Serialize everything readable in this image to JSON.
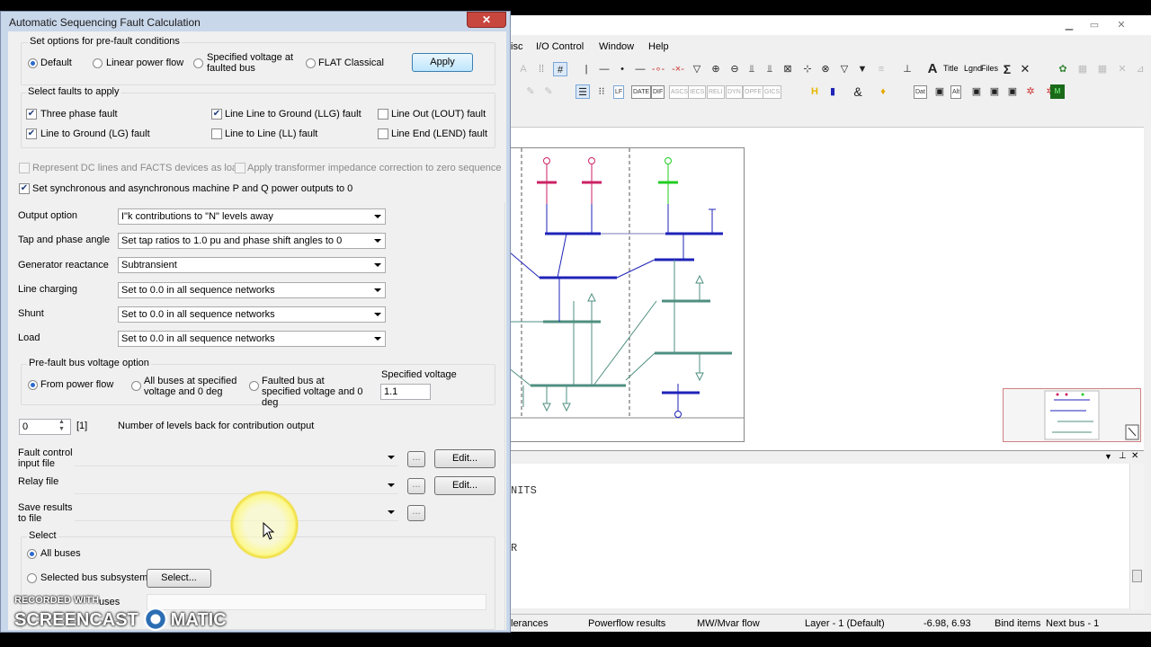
{
  "dialog": {
    "title": "Automatic Sequencing Fault Calculation",
    "close_symbol": "✕",
    "prefault": {
      "title": "Set options for pre-fault conditions",
      "options": [
        "Default",
        "Linear power flow",
        "Specified voltage at faulted bus",
        "FLAT Classical"
      ],
      "selected": "Default",
      "apply_label": "Apply"
    },
    "faults": {
      "title": "Select faults to apply",
      "items": [
        {
          "label": "Three phase fault",
          "checked": true
        },
        {
          "label": "Line Line to Ground (LLG) fault",
          "checked": true
        },
        {
          "label": "Line Out (LOUT) fault",
          "checked": false
        },
        {
          "label": "Line to Ground (LG) fault",
          "checked": true
        },
        {
          "label": "Line to Line (LL) fault",
          "checked": false
        },
        {
          "label": "Line End (LEND) fault",
          "checked": false
        }
      ]
    },
    "checks": {
      "dc_facts": "Represent DC lines and FACTS devices as load",
      "xfmr_correction": "Apply transformer impedance correction to zero sequence",
      "machine_pq": "Set synchronous and asynchronous machine P and Q power outputs to 0"
    },
    "settings": [
      {
        "label": "Output option",
        "value": "I\"k contributions to \"N\" levels away"
      },
      {
        "label": "Tap and phase angle",
        "value": "Set tap ratios to 1.0 pu and phase shift angles to 0"
      },
      {
        "label": "Generator reactance",
        "value": "Subtransient"
      },
      {
        "label": "Line charging",
        "value": "Set to 0.0 in all sequence networks"
      },
      {
        "label": "Shunt",
        "value": "Set to 0.0 in all sequence networks"
      },
      {
        "label": "Load",
        "value": "Set to 0.0 in all sequence networks"
      }
    ],
    "prefault_voltage": {
      "title": "Pre-fault bus voltage option",
      "options": [
        "From power flow",
        "All buses at specified voltage and 0 deg",
        "Faulted bus at specified voltage and 0 deg"
      ],
      "selected": "From power flow",
      "spec_label": "Specified voltage",
      "spec_value": "1.1"
    },
    "levels": {
      "value": "0",
      "bracket": "[1]",
      "label": "Number of levels back for contribution output"
    },
    "files": {
      "fault_control": "Fault control input file",
      "relay": "Relay file",
      "save_results": "Save results to file",
      "browse": "...",
      "edit": "Edit..."
    },
    "select": {
      "title": "Select",
      "all_buses": "All buses",
      "subsystem": "Selected bus subsystem",
      "select_btn": "Select...",
      "partial_label": "uses"
    }
  },
  "app": {
    "menu": [
      "isc",
      "I/O Control",
      "Window",
      "Help"
    ],
    "toolbar_text": [
      "Title",
      "Lgnd",
      "Files"
    ],
    "toolbar_boxes": [
      "LF",
      "DATE",
      "DIF",
      "ASCS",
      "IECS",
      "RELI",
      "DYN",
      "OPFE",
      "GICS"
    ],
    "toolbar_boxes2": [
      "Dat",
      "Alt"
    ],
    "output_lines": [
      "NITS",
      "R"
    ],
    "status": {
      "c1": "lerances",
      "c2": "Powerflow results",
      "c3": "MW/Mvar flow",
      "c4": "Layer - 1 (Default)",
      "c5": "-6.98, 6.93",
      "c6": "Bind items",
      "c7": "Next bus - 1"
    }
  },
  "watermark": {
    "top": "RECORDED WITH",
    "left": "SCREENCAST",
    "right": "MATIC"
  },
  "colors": {
    "dialog_frame": "#c9d7ea",
    "close": "#c7463e",
    "bus_blue": "#1f23b8",
    "bus_teal": "#4f8f80",
    "gen_red": "#cc2266",
    "gen_green": "#22cc22"
  }
}
